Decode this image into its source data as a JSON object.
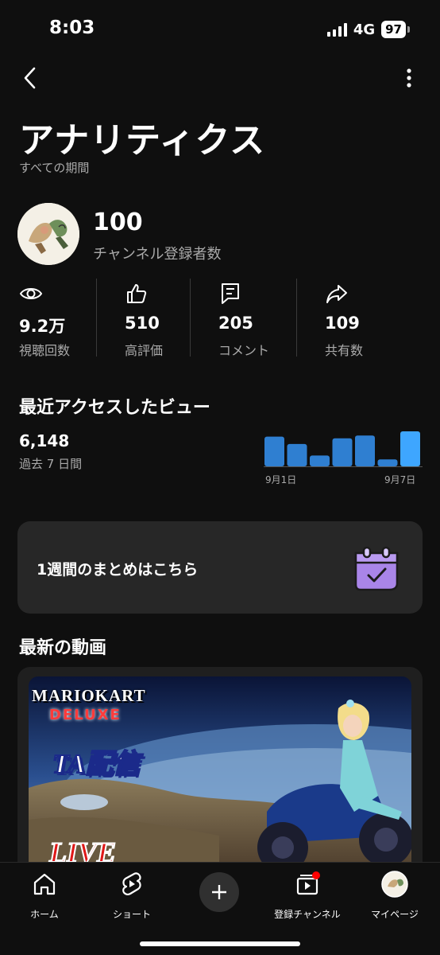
{
  "status": {
    "time": "8:03",
    "network": "4G",
    "battery": "97"
  },
  "header": {
    "back_icon": "chevron-left-icon",
    "more_icon": "more-vert-icon"
  },
  "page": {
    "title": "アナリティクス",
    "period": "すべての期間"
  },
  "channel": {
    "subscribers": "100",
    "subscribers_label": "チャンネル登録者数"
  },
  "metrics": [
    {
      "icon": "eye-icon",
      "value": "9.2万",
      "label": "視聴回数"
    },
    {
      "icon": "thumbs-up-icon",
      "value": "510",
      "label": "高評価"
    },
    {
      "icon": "comment-icon",
      "value": "205",
      "label": "コメント"
    },
    {
      "icon": "share-icon",
      "value": "109",
      "label": "共有数"
    }
  ],
  "recent": {
    "title": "最近アクセスしたビュー",
    "value": "6,148",
    "period": "過去 7 日間",
    "start_label": "9月1日",
    "end_label": "9月7日"
  },
  "chart_data": {
    "type": "bar",
    "categories": [
      "9月1日",
      "",
      "",
      "",
      "",
      "",
      "9月7日"
    ],
    "values": [
      0.85,
      0.64,
      0.31,
      0.8,
      0.88,
      0.2,
      1.0
    ],
    "title": "",
    "xlabel": "",
    "ylabel": "",
    "ylim": [
      0,
      1
    ],
    "colors": [
      "#2f7fd1",
      "#2f7fd1",
      "#2f7fd1",
      "#2f7fd1",
      "#2f7fd1",
      "#2f7fd1",
      "#3ea6ff"
    ]
  },
  "summary": {
    "label": "1週間のまとめはこちら",
    "icon": "calendar-check-icon"
  },
  "latest": {
    "title": "最新の動画",
    "thumb_texts": {
      "mario": "MARIOKART",
      "deluxe": "DELUXE",
      "ta": "TA配信",
      "live": "LIVE"
    }
  },
  "nav": [
    {
      "icon": "home-icon",
      "label": "ホーム"
    },
    {
      "icon": "shorts-icon",
      "label": "ショート"
    },
    {
      "icon": "plus-icon",
      "label": ""
    },
    {
      "icon": "subscriptions-icon",
      "label": "登録チャンネル"
    },
    {
      "icon": "avatar-icon",
      "label": "マイページ"
    }
  ],
  "colors": {
    "background": "#0f0f0f",
    "card": "#272727",
    "accent": "#3ea6ff",
    "bar": "#2f7fd1",
    "badge": "#ff0000"
  }
}
